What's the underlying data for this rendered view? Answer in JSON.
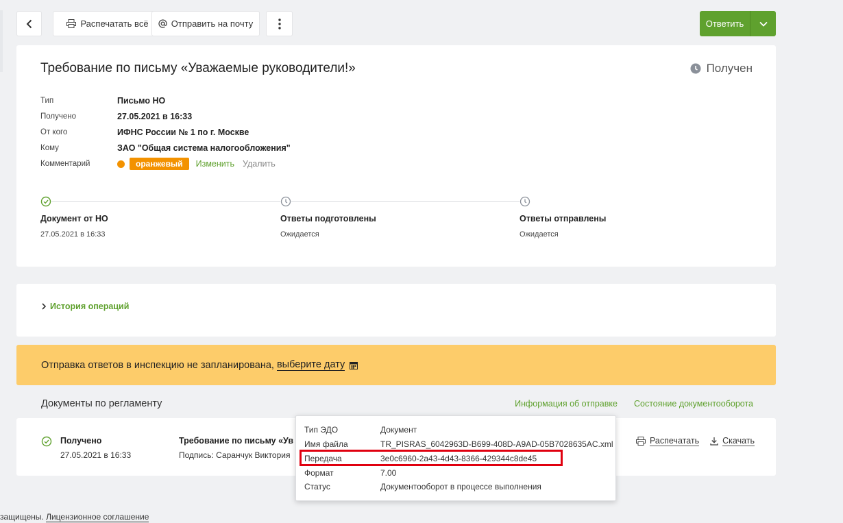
{
  "toolbar": {
    "print_all": "Распечатать всё",
    "send_mail": "Отправить на почту",
    "reply": "Ответить"
  },
  "document": {
    "title": "Требование по письму «Уважаемые руководители!»",
    "status": "Получен",
    "meta": [
      {
        "label": "Тип",
        "value": "Письмо НО"
      },
      {
        "label": "Получено",
        "value": "27.05.2021 в 16:33"
      },
      {
        "label": "От кого",
        "value": "ИФНС России № 1 по г. Москве"
      },
      {
        "label": "Кому",
        "value": "ЗАО \"Общая система налогообложения\""
      }
    ],
    "comment": {
      "label": "Комментарий",
      "tag": "оранжевый",
      "tag_color": "#f39200",
      "edit": "Изменить",
      "delete": "Удалить"
    }
  },
  "steps": [
    {
      "title": "Документ от НО",
      "sub": "27.05.2021 в 16:33",
      "icon": "check-circle-icon"
    },
    {
      "title": "Ответы подготовлены",
      "sub": "Ожидается",
      "icon": "clock-icon"
    },
    {
      "title": "Ответы отправлены",
      "sub": "Ожидается",
      "icon": "clock-icon"
    }
  ],
  "history": {
    "label": "История операций"
  },
  "banner": {
    "text": "Отправка ответов в инспекцию не запланирована,",
    "link": "выберите дату"
  },
  "docs": {
    "heading": "Документы по регламенту",
    "link_send_info": "Информация об отправке",
    "link_flow_state": "Состояние документооборота",
    "item": {
      "status": "Получено",
      "date": "27.05.2021 в 16:33",
      "name": "Требование по письму «Ув",
      "signature": "Подпись: Саранчук Виктория",
      "print": "Распечатать",
      "download": "Скачать"
    }
  },
  "popup": {
    "rows": [
      {
        "label": "Тип ЭДО",
        "value": "Документ"
      },
      {
        "label": "Имя файла",
        "value": "TR_PISRAS_6042963D-B699-408D-A9AD-05B7028635AC.xml"
      },
      {
        "label": "Передача",
        "value": "3e0c6960-2a43-4d43-8366-429344c8de45"
      },
      {
        "label": "Формат",
        "value": "7.00"
      },
      {
        "label": "Статус",
        "value": "Документооборот в процессе выполнения"
      }
    ]
  },
  "footer": {
    "text": "защищены.",
    "link": "Лицензионное соглашение"
  },
  "colors": {
    "accent": "#5fa12e",
    "banner": "#fdcc6a",
    "highlight": "#e0000f"
  }
}
